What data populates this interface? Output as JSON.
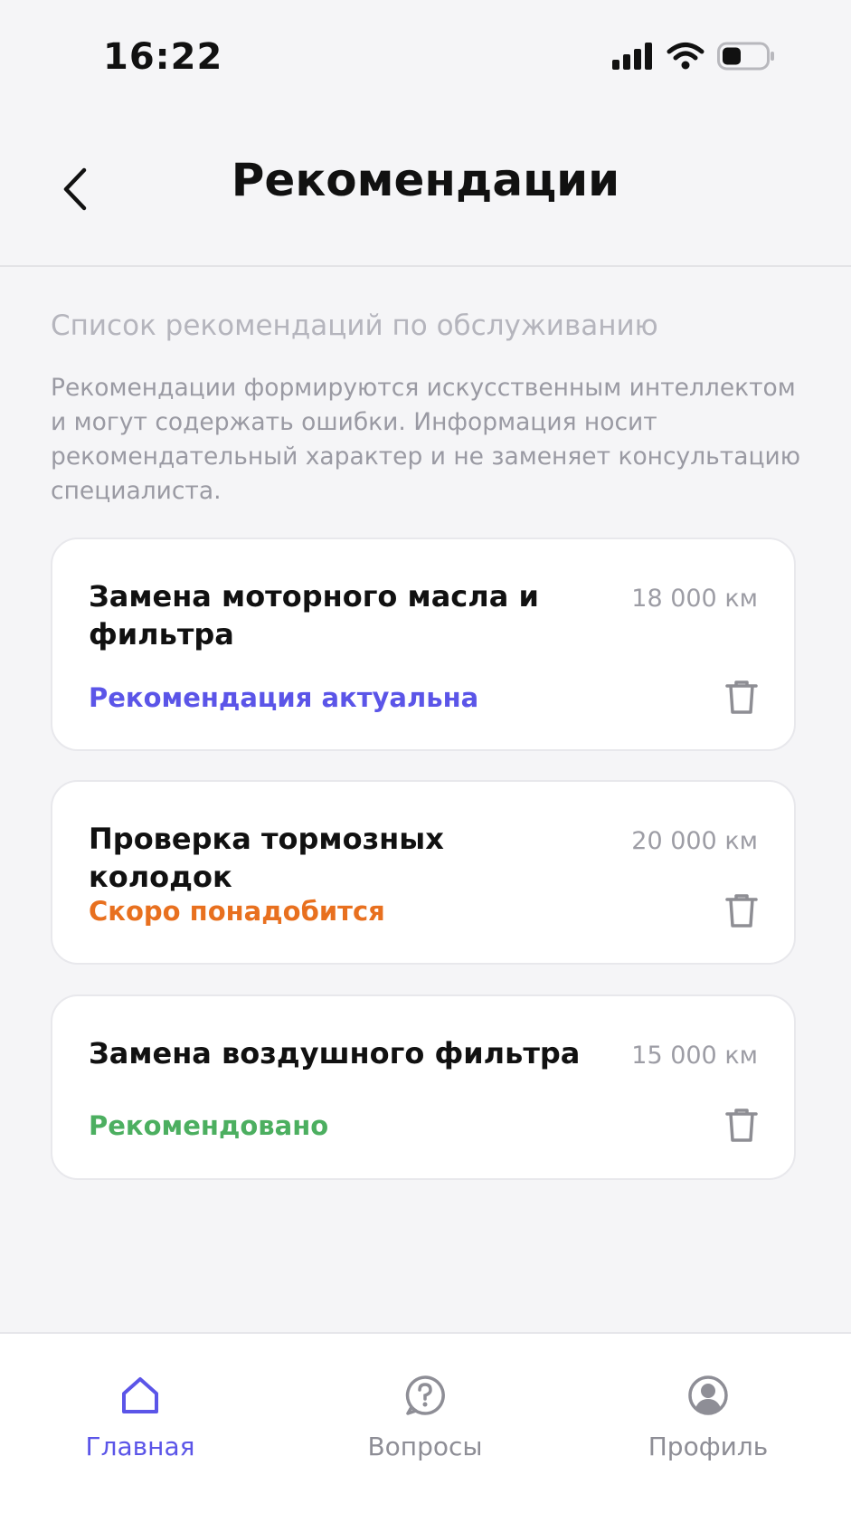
{
  "status_bar": {
    "time": "16:22"
  },
  "header": {
    "title": "Рекомендации"
  },
  "intro": {
    "subtitle": "Список рекомендаций по обслуживанию",
    "disclaimer": "Рекомендации формируются искусственным интеллектом и могут содержать ошибки. Информация носит рекомендательный характер и не заменяет консультацию специалиста."
  },
  "recommendations": [
    {
      "title": "Замена моторного масла и фильтра",
      "mileage": "18 000 км",
      "status": "Рекомендация актуальна",
      "status_color": "#5b55e8"
    },
    {
      "title": "Проверка тормозных колодок",
      "mileage": "20 000 км",
      "status": "Скоро понадобится",
      "status_color": "#e8701f"
    },
    {
      "title": "Замена воздушного фильтра",
      "mileage": "15 000 км",
      "status": "Рекомендовано",
      "status_color": "#4caf60"
    }
  ],
  "tab_bar": {
    "tabs": [
      {
        "label": "Главная",
        "icon": "home-icon",
        "active": true
      },
      {
        "label": "Вопросы",
        "icon": "question-icon",
        "active": false
      },
      {
        "label": "Профиль",
        "icon": "profile-icon",
        "active": false
      }
    ],
    "active_color": "#5b55e8",
    "inactive_color": "#8e8e96"
  }
}
